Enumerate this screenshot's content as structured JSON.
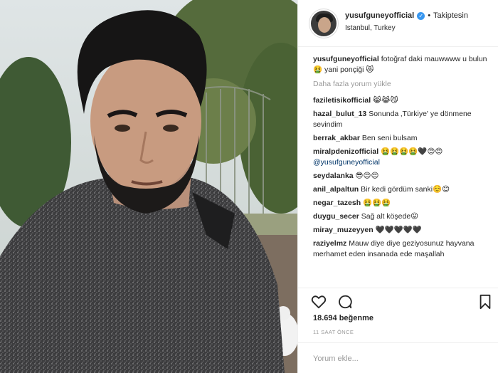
{
  "header": {
    "username": "yusufguneyofficial",
    "separator": "•",
    "follow_label": "Takiptesin",
    "location": "Istanbul, Turkey"
  },
  "caption": {
    "username": "yusufguneyofficial",
    "text": "fotoğraf daki mauwwww u bulun 🤮 yani ponçiği 😻"
  },
  "load_more": "Daha fazla yorum yükle",
  "comments": [
    {
      "user": "faziletisikofficial",
      "text": "😹😹😼"
    },
    {
      "user": "hazal_bulut_13",
      "text": "Sonunda ‚Türkiye' ye dönmene sevindim"
    },
    {
      "user": "berrak_akbar",
      "text": "Ben seni bulsam"
    },
    {
      "user": "miralpdenizofficial",
      "text": "🤮🤮🤮🤮🖤😍😍",
      "mention": "@yusufguneyofficial"
    },
    {
      "user": "seydalanka",
      "text": "😎😍😍"
    },
    {
      "user": "anil_alpaltun",
      "text": "Bir kedi gördüm sanki☺️😊"
    },
    {
      "user": "negar_tazesh",
      "text": "🤮🤮🤮"
    },
    {
      "user": "duygu_secer",
      "text": "Sağ alt köşede😛"
    },
    {
      "user": "miray_muzeyyen",
      "text": "🖤🖤🖤🖤🖤"
    },
    {
      "user": "raziyelmz",
      "text": "Mauw diye diye geziyosunuz hayvana merhamet eden insanada ede maşallah"
    }
  ],
  "likes": "18.694 beğenme",
  "time": "11 SAAT ÖNCE",
  "add_comment_placeholder": "Yorum ekle...",
  "colors": {
    "accent_blue": "#3897f0",
    "text": "#262626",
    "muted": "#999999",
    "border": "#efefef"
  }
}
